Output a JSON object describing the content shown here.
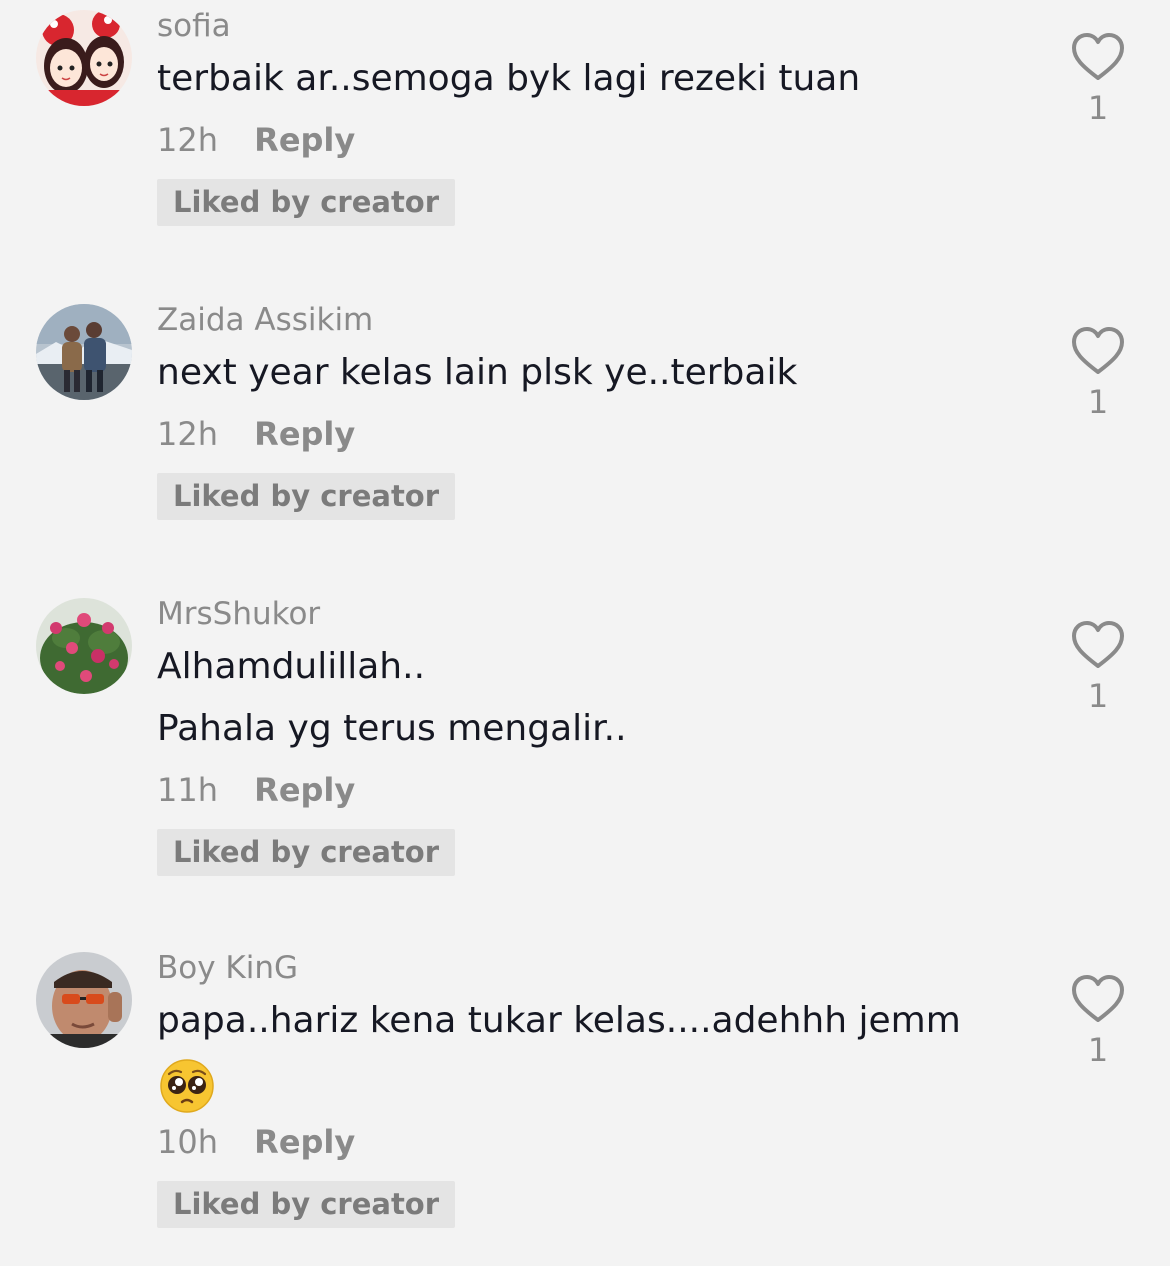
{
  "comments": [
    {
      "username": "sofia",
      "text": "terbaik ar..semoga byk lagi rezeki tuan",
      "time": "12h",
      "reply_label": "Reply",
      "liked_label": "Liked by creator",
      "like_count": "1",
      "avatar": "cartoon-girls-avatar"
    },
    {
      "username": "Zaida Assikim",
      "text": "next year kelas lain plsk ye..terbaik",
      "time": "12h",
      "reply_label": "Reply",
      "liked_label": "Liked by creator",
      "like_count": "1",
      "avatar": "couple-snow-avatar"
    },
    {
      "username": "MrsShukor",
      "text": "Alhamdulillah..\nPahala yg terus mengalir..",
      "time": "11h",
      "reply_label": "Reply",
      "liked_label": "Liked by creator",
      "like_count": "1",
      "avatar": "roses-avatar"
    },
    {
      "username": "Boy KinG",
      "text": "papa..hariz kena tukar kelas....adehhh jemm",
      "emoji": "pleading-face",
      "time": "10h",
      "reply_label": "Reply",
      "liked_label": "Liked by creator",
      "like_count": "1",
      "avatar": "man-sunglasses-avatar"
    }
  ],
  "colors": {
    "background": "#f3f3f3",
    "username": "#8a8a8a",
    "text": "#161823",
    "badge_bg": "#e4e4e4"
  }
}
